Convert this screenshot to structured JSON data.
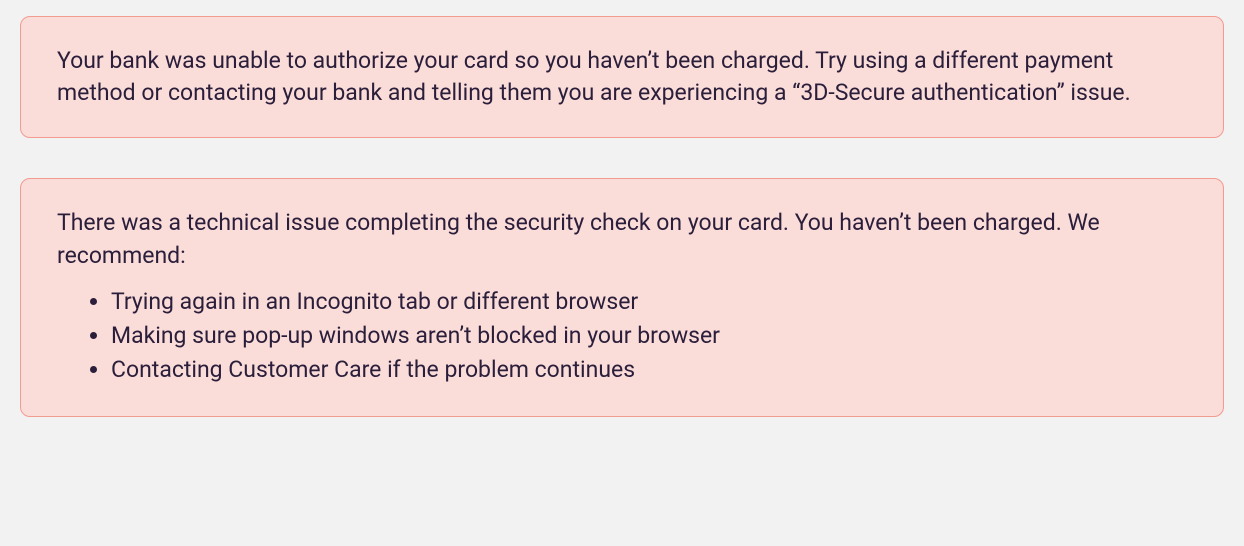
{
  "alerts": [
    {
      "message": "Your bank was unable to authorize your card so you haven’t been charged. Try using a different payment method or contacting your bank and telling them you are experiencing a “3D-Secure authentication” issue."
    },
    {
      "message": "There was a technical issue completing the security check on your card. You haven’t been charged. We recommend:",
      "items": [
        "Trying again in an Incognito tab or different browser",
        "Making sure pop-up windows aren’t blocked in your browser",
        "Contacting Customer Care if the problem continues"
      ]
    }
  ]
}
